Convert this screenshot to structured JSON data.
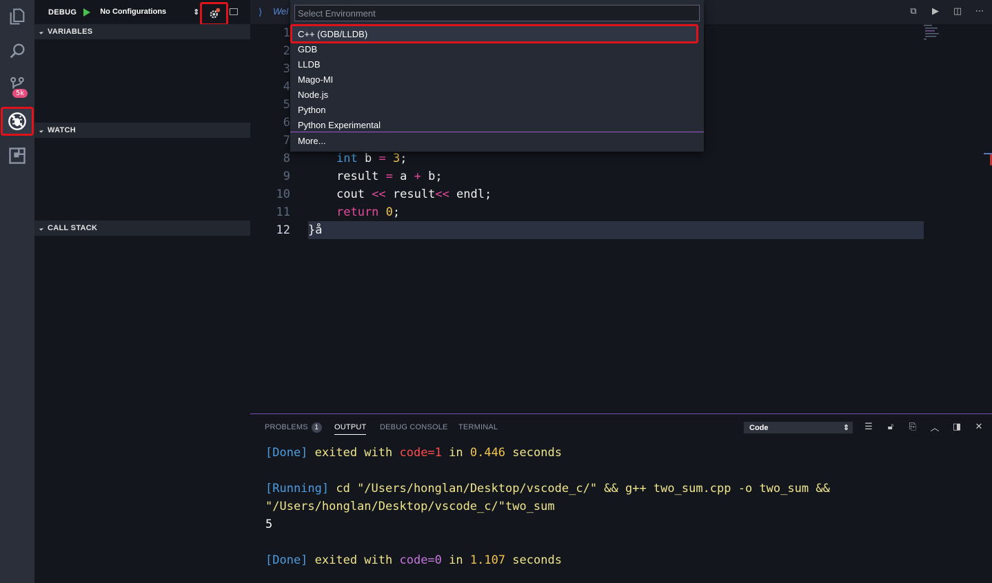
{
  "debug_toolbar": {
    "title": "DEBUG",
    "configuration": "No Configurations"
  },
  "sections": {
    "variables": "VARIABLES",
    "watch": "WATCH",
    "call_stack": "CALL STACK"
  },
  "activity_bar": {
    "scm_badge": "5k"
  },
  "editor": {
    "tab_label": "Wel",
    "lines": [
      {
        "num": "1"
      },
      {
        "num": "2"
      },
      {
        "num": "3"
      },
      {
        "num": "4"
      },
      {
        "num": "5"
      },
      {
        "num": "6"
      },
      {
        "num": "7"
      },
      {
        "num": "8"
      },
      {
        "num": "9"
      },
      {
        "num": "10"
      },
      {
        "num": "11"
      },
      {
        "num": "12"
      }
    ],
    "code": {
      "l8_type": "int",
      "l8_rest": " b ",
      "l8_eq": "=",
      "l8_num": "3",
      "l8_end": ";",
      "l9_a": "result ",
      "l9_eq": "=",
      "l9_b": " a ",
      "l9_plus": "+",
      "l9_c": " b;",
      "l10_a": "cout ",
      "l10_op1": "<<",
      "l10_b": " result",
      "l10_op2": "<<",
      "l10_c": " endl;",
      "l11_kw": "return",
      "l11_num": "0",
      "l11_end": ";",
      "l12": "}å"
    }
  },
  "quick_pick": {
    "placeholder": "Select Environment",
    "items": [
      "C++ (GDB/LLDB)",
      "GDB",
      "LLDB",
      "Mago-MI",
      "Node.js",
      "Python",
      "Python Experimental",
      "More..."
    ]
  },
  "panel": {
    "tabs": {
      "problems": "PROBLEMS",
      "problems_count": "1",
      "output": "OUTPUT",
      "debug_console": "DEBUG CONSOLE",
      "terminal": "TERMINAL"
    },
    "output_channel": "Code",
    "output": {
      "l1_tag": "[Done]",
      "l1_a": " exited with ",
      "l1_code": "code=1",
      "l1_b": " in ",
      "l1_time": "0.446",
      "l1_c": " seconds",
      "l2_tag": "[Running]",
      "l2_cmd": " cd \"/Users/honglan/Desktop/vscode_c/\" && g++ two_sum.cpp -o two_sum &&",
      "l3": "\"/Users/honglan/Desktop/vscode_c/\"two_sum",
      "l4": "5",
      "l5_tag": "[Done]",
      "l5_a": " exited with ",
      "l5_code": "code=0",
      "l5_b": " in ",
      "l5_time": "1.107",
      "l5_c": " seconds"
    }
  },
  "colors": {
    "accent_red": "#e0131a",
    "activity_bg": "#2a2f3a",
    "editor_bg": "#13161d",
    "panel_border": "#7b4fb5"
  }
}
